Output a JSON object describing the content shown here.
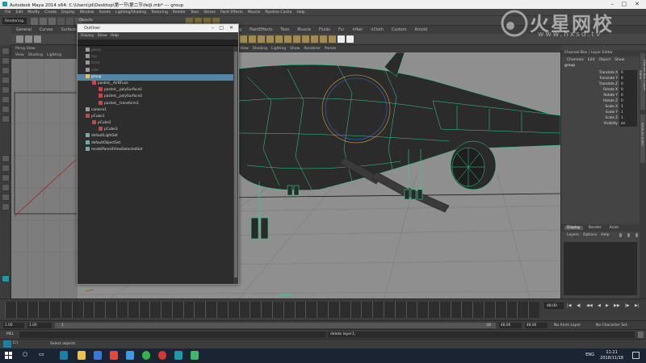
{
  "window": {
    "title": "Autodesk Maya 2014 x64: C:\\Users\\jd\\Desktop\\第一节\\第二节\\feiJi.mb*  ---  group",
    "controls": [
      "minimize",
      "maximize",
      "close"
    ]
  },
  "menubar": {
    "items": [
      "File",
      "Edit",
      "Modify",
      "Create",
      "Display",
      "Window",
      "Assets",
      "Lighting/Shading",
      "Texturing",
      "Render",
      "Toon",
      "Stereo",
      "Paint Effects",
      "Muscle",
      "Pipeline Cache",
      "Help"
    ]
  },
  "statusline": {
    "mode": "Rendering",
    "field_label": "Objects"
  },
  "shelf": {
    "tabs": [
      "General",
      "Curves",
      "Surfaces",
      "Polygons",
      "Subdivs",
      "Deformation",
      "Animation",
      "Dynamics",
      "Rendering",
      "PaintEffects",
      "Toon",
      "Muscle",
      "Fluids",
      "Fur",
      "nHair",
      "nCloth",
      "Custom",
      "Arnold"
    ]
  },
  "top_view": {
    "title": "Persp View",
    "menu": [
      "View",
      "Shading",
      "Lighting",
      "Show",
      "Renderer",
      "Panels"
    ]
  },
  "viewport": {
    "menu": [
      "View",
      "Shading",
      "Lighting",
      "Show",
      "Renderer",
      "Panels"
    ],
    "camera_label": "persp"
  },
  "outliner": {
    "title": "Outliner",
    "menu": [
      "Display",
      "Show",
      "Help"
    ],
    "items": [
      {
        "label": "persp",
        "indent": 0,
        "state": "dim",
        "icon": "camera-icon"
      },
      {
        "label": "top",
        "indent": 0,
        "state": "dim",
        "icon": "camera-icon"
      },
      {
        "label": "front",
        "indent": 0,
        "state": "dim",
        "icon": "camera-icon"
      },
      {
        "label": "side",
        "indent": 0,
        "state": "dim",
        "icon": "camera-icon"
      },
      {
        "label": "group",
        "indent": 0,
        "state": "selected",
        "icon": "group-icon"
      },
      {
        "label": "pasted__AirBFuse",
        "indent": 1,
        "state": "normal",
        "icon": "mesh-icon"
      },
      {
        "label": "pasted__polySurface1",
        "indent": 2,
        "state": "normal",
        "icon": "mesh-icon"
      },
      {
        "label": "pasted__polySurface2",
        "indent": 2,
        "state": "normal",
        "icon": "mesh-icon"
      },
      {
        "label": "pasted__transform1",
        "indent": 2,
        "state": "normal",
        "icon": "mesh-icon"
      },
      {
        "label": "camera1",
        "indent": 0,
        "state": "normal",
        "icon": "camera-icon"
      },
      {
        "label": "pCube1",
        "indent": 0,
        "state": "normal",
        "icon": "mesh-icon"
      },
      {
        "label": "pCube2",
        "indent": 1,
        "state": "normal",
        "icon": "mesh-icon"
      },
      {
        "label": "pCube3",
        "indent": 2,
        "state": "normal",
        "icon": "mesh-icon"
      },
      {
        "label": "defaultLightSet",
        "indent": 0,
        "state": "normal",
        "icon": "set-icon"
      },
      {
        "label": "defaultObjectSet",
        "indent": 0,
        "state": "normal",
        "icon": "set-icon"
      },
      {
        "label": "modelPanel4ViewSelectedSet",
        "indent": 0,
        "state": "normal",
        "icon": "set-icon"
      }
    ]
  },
  "channel_box": {
    "header": "Channel Box / Layer Editor",
    "menu": [
      "Channels",
      "Edit",
      "Object",
      "Show"
    ],
    "object_name": "group",
    "attributes": [
      {
        "label": "Translate X",
        "value": "0"
      },
      {
        "label": "Translate Y",
        "value": "0"
      },
      {
        "label": "Translate Z",
        "value": "0"
      },
      {
        "label": "Rotate X",
        "value": "0"
      },
      {
        "label": "Rotate Y",
        "value": "0"
      },
      {
        "label": "Rotate Z",
        "value": "0"
      },
      {
        "label": "Scale X",
        "value": "1"
      },
      {
        "label": "Scale Y",
        "value": "1"
      },
      {
        "label": "Scale Z",
        "value": "1"
      },
      {
        "label": "Visibility",
        "value": "on"
      }
    ]
  },
  "layer_editor": {
    "tabs": [
      "Display",
      "Render",
      "Anim"
    ],
    "menu": [
      "Layers",
      "Options",
      "Help"
    ]
  },
  "side_tabs": [
    "Channel Box / Layer Editor",
    "Attribute Editor"
  ],
  "time_slider": {
    "current_frame": "1.00",
    "end_frame": "48.00"
  },
  "range_slider": {
    "start_time": "1.00",
    "start_field": "1.00",
    "range_start": "1",
    "range_end": "48",
    "end_field": "48.00",
    "end_time": "48.00",
    "anim_layer": "No Anim Layer",
    "character_set": "No Character Set"
  },
  "command_line": {
    "label": "MEL",
    "result": "delete layer1;"
  },
  "help_line": {
    "status": "Select objects"
  },
  "taskbar": {
    "time": "11:21",
    "date": "2018/11/18",
    "lang": "ENG"
  },
  "watermark": {
    "text": "火星网校",
    "url": "www.hxsd.tv"
  },
  "colors": {
    "wireframe": "#2bd68a",
    "selection": "#5285a6",
    "viewport_bg": "#8f8f8f"
  }
}
